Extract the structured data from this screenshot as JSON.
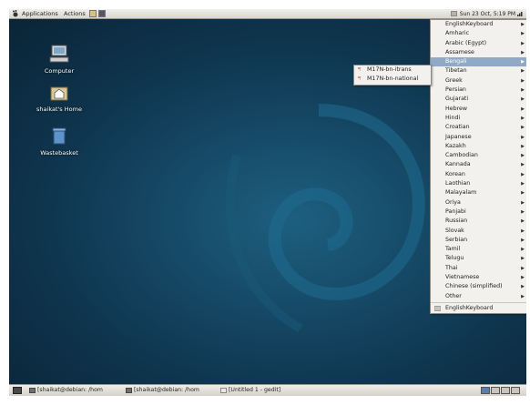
{
  "top_panel": {
    "applications_label": "Applications",
    "actions_label": "Actions",
    "clock": "Sun 23 Oct,  5:19 PM"
  },
  "desktop_icons": [
    {
      "label": "Computer",
      "icon": "computer-icon"
    },
    {
      "label": "shaikat's Home",
      "icon": "home-folder-icon"
    },
    {
      "label": "Wastebasket",
      "icon": "trash-icon"
    }
  ],
  "keyboard_menu": {
    "items": [
      {
        "label": "EnglishKeyboard",
        "submenu": true
      },
      {
        "label": "Amharic",
        "submenu": true
      },
      {
        "label": "Arabic (Egypt)",
        "submenu": true
      },
      {
        "label": "Assamese",
        "submenu": true
      },
      {
        "label": "Bengali",
        "submenu": true,
        "selected": true
      },
      {
        "label": "Tibetan",
        "submenu": true
      },
      {
        "label": "Greek",
        "submenu": true
      },
      {
        "label": "Persian",
        "submenu": true
      },
      {
        "label": "Gujarati",
        "submenu": true
      },
      {
        "label": "Hebrew",
        "submenu": true
      },
      {
        "label": "Hindi",
        "submenu": true
      },
      {
        "label": "Croatian",
        "submenu": true
      },
      {
        "label": "Japanese",
        "submenu": true
      },
      {
        "label": "Kazakh",
        "submenu": true
      },
      {
        "label": "Cambodian",
        "submenu": true
      },
      {
        "label": "Kannada",
        "submenu": true
      },
      {
        "label": "Korean",
        "submenu": true
      },
      {
        "label": "Laothian",
        "submenu": true
      },
      {
        "label": "Malayalam",
        "submenu": true
      },
      {
        "label": "Oriya",
        "submenu": true
      },
      {
        "label": "Panjabi",
        "submenu": true
      },
      {
        "label": "Russian",
        "submenu": true
      },
      {
        "label": "Slovak",
        "submenu": true
      },
      {
        "label": "Serbian",
        "submenu": true
      },
      {
        "label": "Tamil",
        "submenu": true
      },
      {
        "label": "Telugu",
        "submenu": true
      },
      {
        "label": "Thai",
        "submenu": true
      },
      {
        "label": "Vietnamese",
        "submenu": true
      },
      {
        "label": "Chinese (simplified)",
        "submenu": true
      },
      {
        "label": "Other",
        "submenu": true
      }
    ],
    "footer_label": "EnglishKeyboard"
  },
  "bengali_submenu": {
    "items": [
      {
        "label": "M17N-bn-itrans"
      },
      {
        "label": "M17N-bn-national"
      }
    ]
  },
  "bottom_panel": {
    "tasks": [
      {
        "label": "[shaikat@debian: /hom"
      },
      {
        "label": "[shaikat@debian: /hom"
      },
      {
        "label": "[Untitled 1 - gedit]"
      }
    ]
  },
  "colors": {
    "menu_highlight": "#8fa9c7",
    "desktop_blue": "#164b68"
  }
}
